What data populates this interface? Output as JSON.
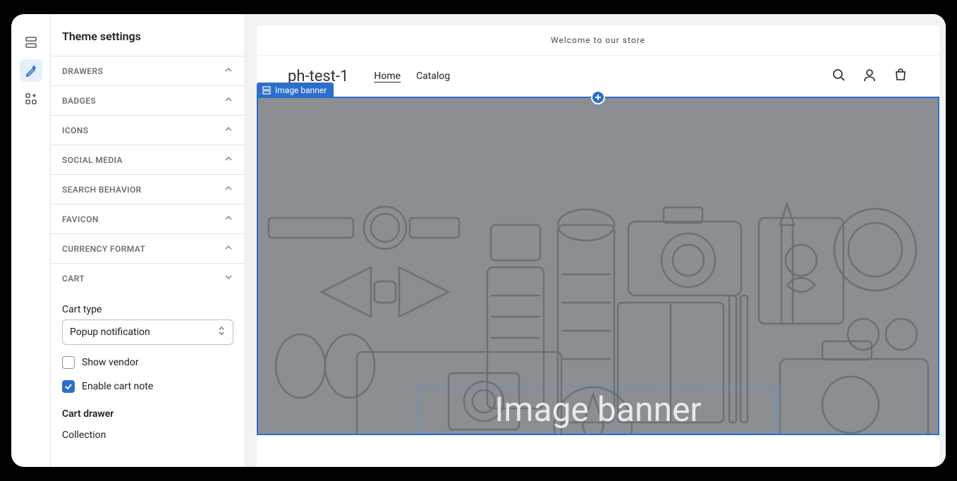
{
  "sidebar": {
    "title": "Theme settings",
    "sections": [
      {
        "label": "DRAWERS"
      },
      {
        "label": "BADGES"
      },
      {
        "label": "ICONS"
      },
      {
        "label": "SOCIAL MEDIA"
      },
      {
        "label": "SEARCH BEHAVIOR"
      },
      {
        "label": "FAVICON"
      },
      {
        "label": "CURRENCY FORMAT"
      }
    ],
    "cart": {
      "label": "CART",
      "cart_type_label": "Cart type",
      "cart_type_value": "Popup notification",
      "show_vendor_label": "Show vendor",
      "enable_cart_note_label": "Enable cart note",
      "drawer_heading": "Cart drawer",
      "collection_label": "Collection"
    }
  },
  "preview": {
    "announcement": "Welcome to our store",
    "brand": "ph-test-1",
    "nav": {
      "home": "Home",
      "catalog": "Catalog"
    },
    "section_pill": "Image banner",
    "banner_title": "Image banner"
  }
}
